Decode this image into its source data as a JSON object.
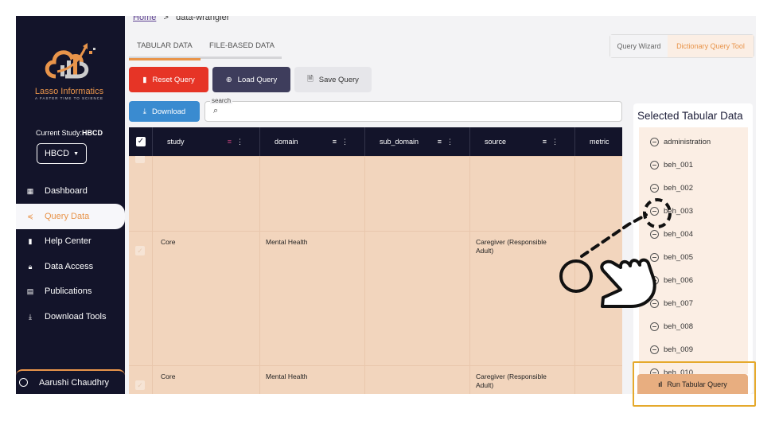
{
  "sidebar": {
    "brand": "Lasso Informatics",
    "tagline": "A FASTER TIME TO SCIENCE",
    "current_study_label": "Current Study:",
    "current_study": "HBCD",
    "study_select": "HBCD",
    "items": [
      {
        "label": "Dashboard",
        "icon": "dashboard-icon"
      },
      {
        "label": "Query Data",
        "icon": "query-icon",
        "active": true
      },
      {
        "label": "Help Center",
        "icon": "book-icon"
      },
      {
        "label": "Data Access",
        "icon": "lock-icon"
      },
      {
        "label": "Publications",
        "icon": "document-icon"
      },
      {
        "label": "Download Tools",
        "icon": "download-icon"
      }
    ],
    "user": "Aarushi Chaudhry"
  },
  "breadcrumb": {
    "home": "Home",
    "sep": ">",
    "current": "data-wrangler"
  },
  "tabs": [
    "TABULAR DATA",
    "FILE-BASED DATA"
  ],
  "toolbar": {
    "reset": "Reset Query",
    "load": "Load Query",
    "save": "Save Query",
    "download": "Download",
    "search_label": "search",
    "search_value": ""
  },
  "mode_toggle": {
    "wizard": "Query Wizard",
    "dictionary": "Dictionary Query Tool",
    "active": "Dictionary Query Tool"
  },
  "table": {
    "columns": [
      "study",
      "domain",
      "sub_domain",
      "source",
      "metric"
    ],
    "rows": [
      {
        "study": "",
        "domain": "",
        "sub_domain": "",
        "source": "",
        "metric": ""
      },
      {
        "study": "Core",
        "domain": "Mental Health",
        "sub_domain": "",
        "source": "Caregiver (Responsible Adult)",
        "metric": ""
      },
      {
        "study": "Core",
        "domain": "Mental Health",
        "sub_domain": "",
        "source": "Caregiver (Responsible Adult)",
        "metric": ""
      }
    ]
  },
  "selected_panel": {
    "title": "Selected Tabular Data",
    "items": [
      "administration",
      "beh_001",
      "beh_002",
      "beh_003",
      "beh_004",
      "beh_005",
      "beh_006",
      "beh_007",
      "beh_008",
      "beh_009",
      "beh_010"
    ],
    "run": "Run Tabular Query"
  },
  "colors": {
    "accent": "#e8944a",
    "sidebar": "#13142a",
    "reset": "#e63426",
    "load": "#3e3d5c",
    "download": "#3a8bd0",
    "row": "#f2d5bd",
    "highlight": "#e5a92c"
  }
}
